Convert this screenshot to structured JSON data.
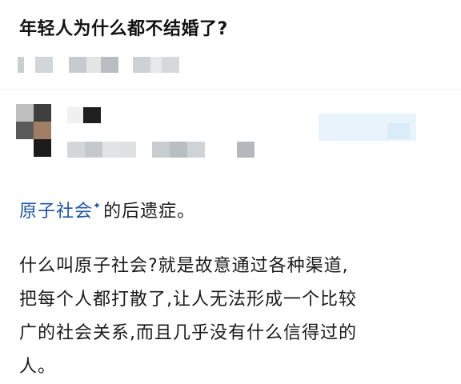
{
  "question": {
    "title": "年轻人为什么都不结婚了?"
  },
  "answer": {
    "link_term": "原子社会",
    "lead_suffix": "的后遗症。",
    "paragraph_lines": [
      "什么叫原子社会?就是故意通过各种渠道,",
      "把每个人都打散了,让人无法形成一个比较",
      "广的社会关系,而且几乎没有什么信得过的",
      "人。"
    ]
  },
  "icons": {
    "link_marker": "sparkle-icon"
  },
  "colors": {
    "link": "#1e55a8",
    "text": "#1a1a1a",
    "title": "#121212",
    "divider": "#ececec",
    "background": "#ffffff"
  }
}
